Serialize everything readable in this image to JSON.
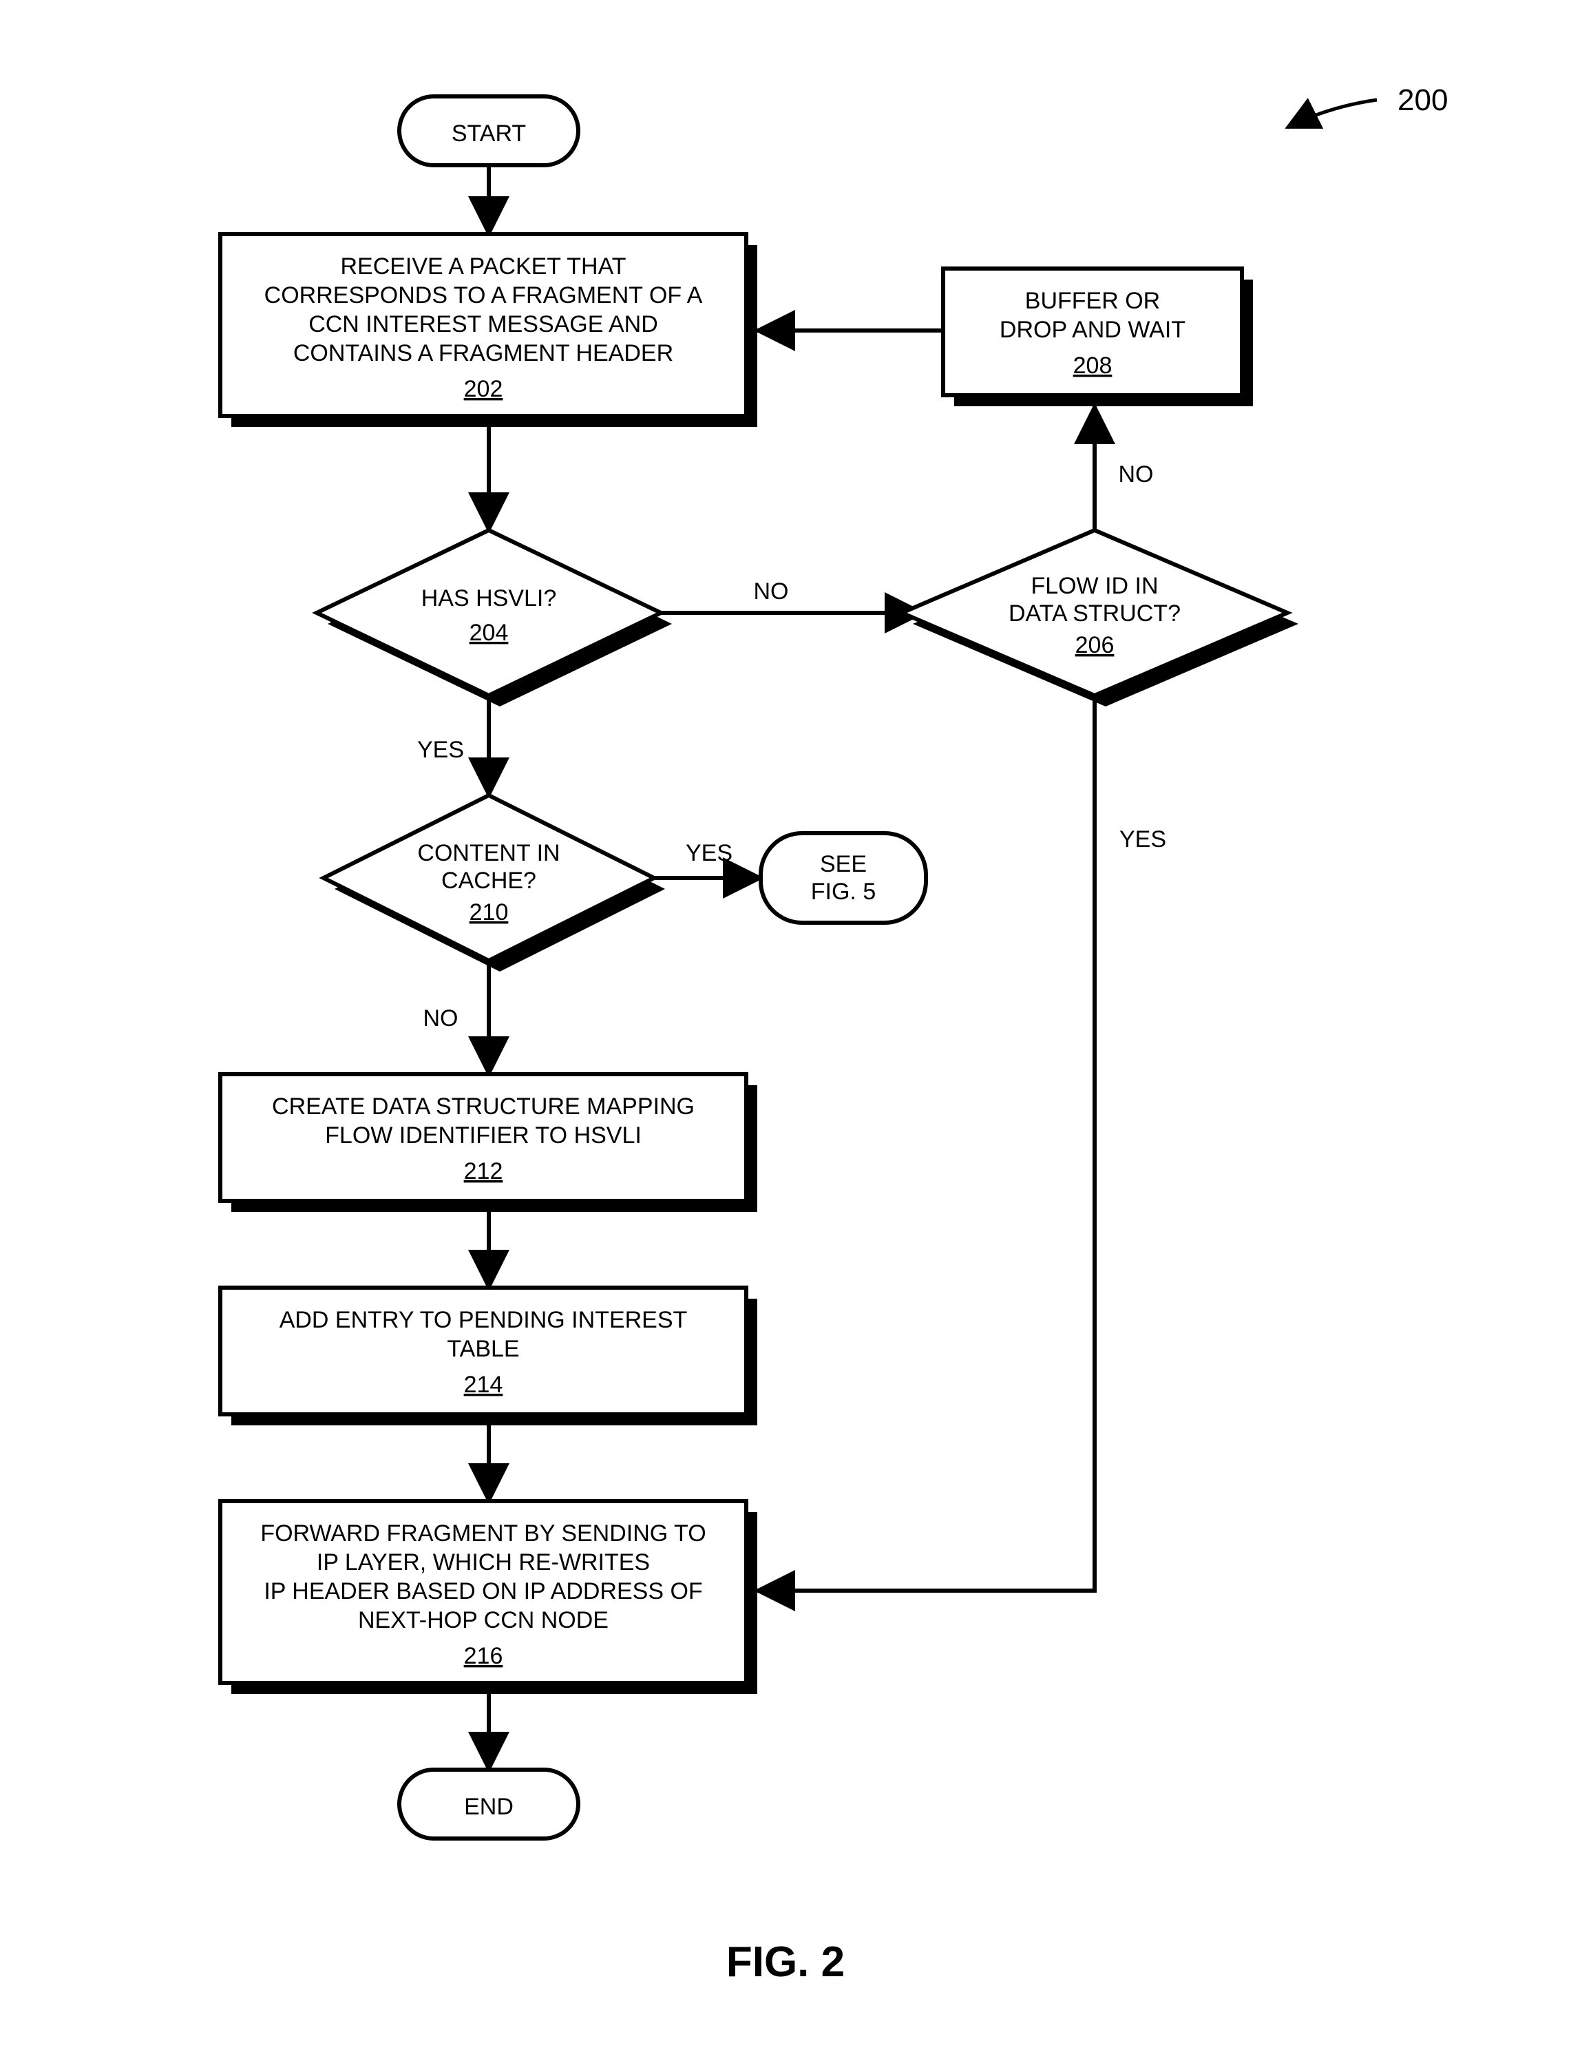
{
  "figure": {
    "number": "200",
    "title": "FIG. 2"
  },
  "nodes": {
    "start": "START",
    "end": "END",
    "seefig5_l1": "SEE",
    "seefig5_l2": "FIG. 5",
    "n202_l1": "RECEIVE A PACKET THAT",
    "n202_l2": "CORRESPONDS TO A FRAGMENT OF A",
    "n202_l3": "CCN INTEREST MESSAGE AND",
    "n202_l4": "CONTAINS A FRAGMENT HEADER",
    "n202_ref": "202",
    "n204_l1": "HAS HSVLI?",
    "n204_ref": "204",
    "n206_l1": "FLOW ID IN",
    "n206_l2": "DATA STRUCT?",
    "n206_ref": "206",
    "n208_l1": "BUFFER OR",
    "n208_l2": "DROP AND WAIT",
    "n208_ref": "208",
    "n210_l1": "CONTENT IN",
    "n210_l2": "CACHE?",
    "n210_ref": "210",
    "n212_l1": "CREATE DATA STRUCTURE MAPPING",
    "n212_l2": "FLOW IDENTIFIER TO HSVLI",
    "n212_ref": "212",
    "n214_l1": "ADD ENTRY TO PENDING INTEREST",
    "n214_l2": "TABLE",
    "n214_ref": "214",
    "n216_l1": "FORWARD FRAGMENT BY SENDING TO",
    "n216_l2": "IP LAYER, WHICH RE-WRITES",
    "n216_l3": "IP HEADER BASED ON IP ADDRESS OF",
    "n216_l4": "NEXT-HOP CCN NODE",
    "n216_ref": "216"
  },
  "edges": {
    "yes": "YES",
    "no": "NO"
  }
}
